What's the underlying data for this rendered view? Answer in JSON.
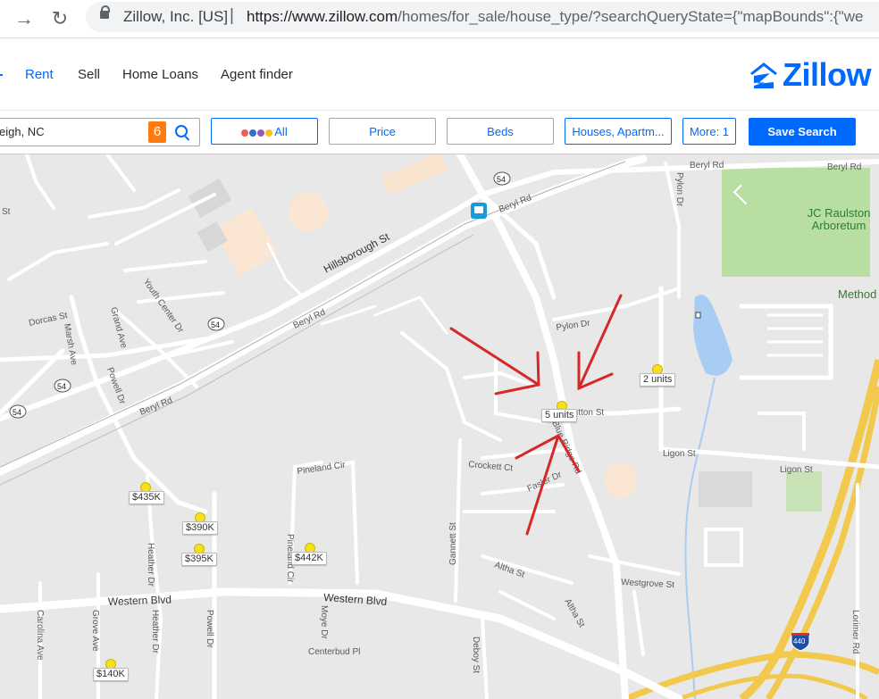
{
  "browser": {
    "site_org": "Zillow, Inc. [US]",
    "url_domain": "https://www.zillow.com",
    "url_path": "/homes/for_sale/house_type/?searchQueryState={\"mapBounds\":{\"we"
  },
  "header": {
    "nav": [
      "Rent",
      "Sell",
      "Home Loans",
      "Agent finder"
    ],
    "logo_text": "Zillow"
  },
  "filters": {
    "search_value": "eigh, NC",
    "badge_count": "6",
    "listing_type_label": "All",
    "price_label": "Price",
    "beds_label": "Beds",
    "home_type_label": "Houses, Apartm...",
    "more_label": "More: 1",
    "save_label": "Save Search",
    "dot_colors": [
      "#f25c54",
      "#2f6fd1",
      "#9b59b6",
      "#f7c21a"
    ]
  },
  "map": {
    "streets": {
      "beryl_rd_1": "Beryl Rd",
      "beryl_rd_2": "Beryl Rd",
      "beryl_rd_3": "Beryl Rd",
      "beryl_rd_4": "Beryl Rd",
      "beryl_rd_5": "Beryl Rd",
      "hillsborough": "Hillsborough St",
      "pylon_dr_1": "Pylon Dr",
      "pylon_dr_2": "Pylon Dr",
      "youth_center": "Youth Center Dr",
      "dorcas": "Dorcas St",
      "marsh": "Marsh Ave",
      "grand": "Grand Ave",
      "powell_dr_1": "Powell Dr",
      "powell_dr_2": "Powell Dr",
      "sutton": "Sutton St",
      "blue_ridge": "Blue Ridge Rd",
      "crockett": "Crockett Ct",
      "fasler": "Fasler Dr",
      "ligon_1": "Ligon St",
      "ligon_2": "Ligon St",
      "pineland_cir_1": "Pineland Cir",
      "pineland_cir_2": "Pineland Cir",
      "heather_1": "Heather Dr",
      "heather_2": "Heather Dr",
      "western_1": "Western Blvd",
      "western_2": "Western Blvd",
      "gannett": "Gannett St",
      "altha_1": "Altha St",
      "altha_2": "Altha St",
      "westgrove": "Westgrove St",
      "carolina": "Carolina Ave",
      "grove": "Grove Ave",
      "moye": "Moye Dr",
      "centerbud": "Centerbud Pl",
      "deboy": "Deboy St",
      "lorimer": "Lorimer Rd",
      "st_edge": "St"
    },
    "shields": {
      "r54": "54",
      "i440": "440"
    },
    "poi": {
      "arboretum": "JC Raulston Arboretum",
      "method": "Method"
    },
    "markers": [
      {
        "label": "2 units"
      },
      {
        "label": "5 units"
      },
      {
        "label": "$435K"
      },
      {
        "label": "$390K"
      },
      {
        "label": "$395K"
      },
      {
        "label": "$442K"
      },
      {
        "label": "$140K"
      }
    ]
  }
}
